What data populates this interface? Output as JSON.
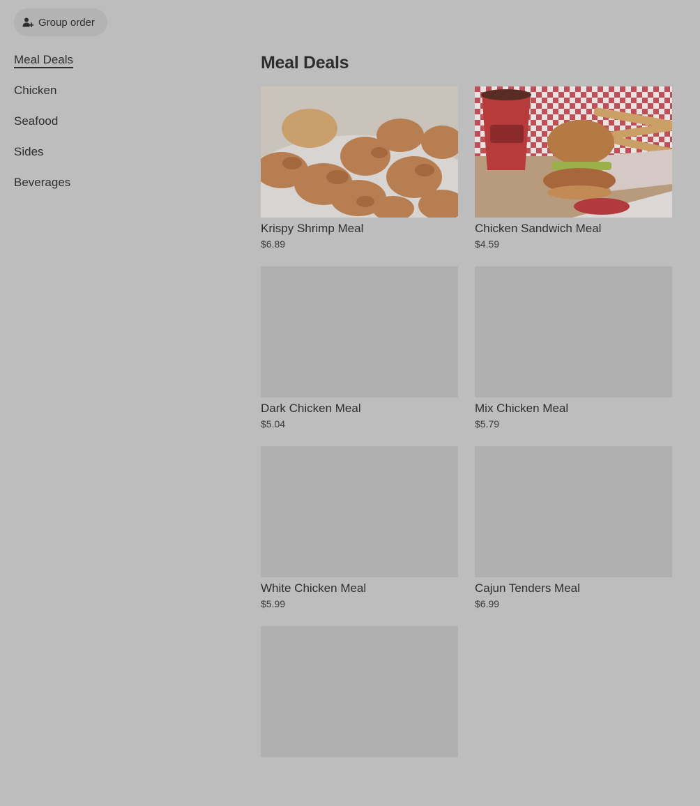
{
  "header": {
    "group_order_label": "Group order"
  },
  "categories": [
    {
      "label": "Meal Deals",
      "active": true
    },
    {
      "label": "Chicken"
    },
    {
      "label": "Seafood"
    },
    {
      "label": "Sides"
    },
    {
      "label": "Beverages"
    }
  ],
  "section": {
    "title": "Meal Deals"
  },
  "items": [
    {
      "name": "Krispy Shrimp Meal",
      "price": "$6.89",
      "image": "fried-shrimp-photo"
    },
    {
      "name": "Chicken Sandwich Meal",
      "price": "$4.59",
      "image": "chicken-sandwich-meal-photo"
    },
    {
      "name": "Dark Chicken Meal",
      "price": "$5.04",
      "image": "placeholder"
    },
    {
      "name": "Mix Chicken Meal",
      "price": "$5.79",
      "image": "placeholder"
    },
    {
      "name": "White Chicken Meal",
      "price": "$5.99",
      "image": "placeholder"
    },
    {
      "name": "Cajun Tenders Meal",
      "price": "$6.99",
      "image": "placeholder"
    },
    {
      "name": "",
      "price": "",
      "image": "placeholder"
    }
  ]
}
